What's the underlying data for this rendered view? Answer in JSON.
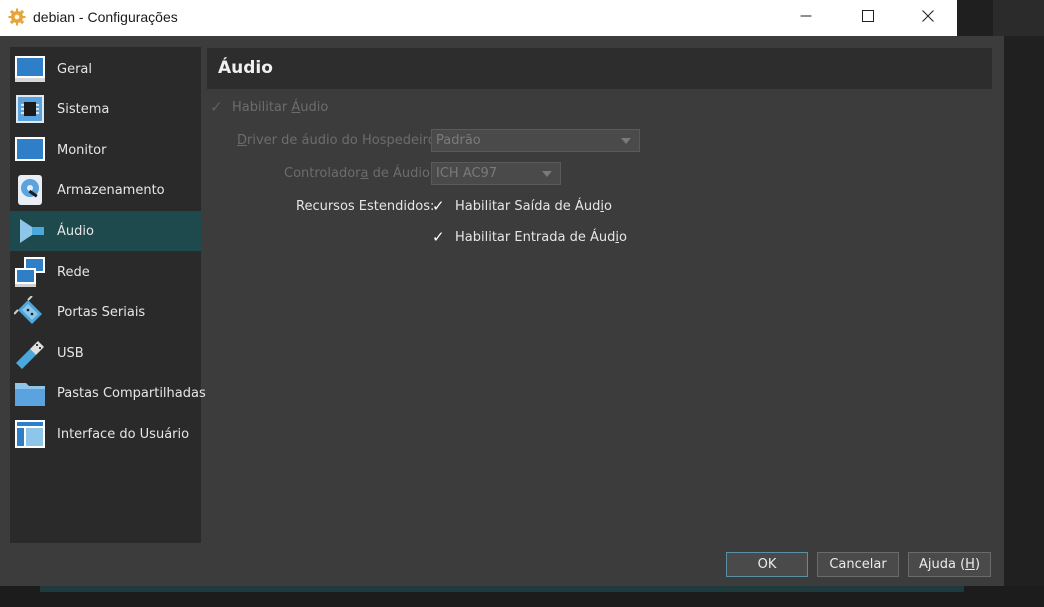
{
  "window": {
    "title": "debian - Configurações",
    "minimize_label": "",
    "maximize_label": "",
    "close_label": ""
  },
  "sidebar": {
    "items": [
      {
        "label": "Geral",
        "icon": "monitor-general-icon"
      },
      {
        "label": "Sistema",
        "icon": "chip-icon"
      },
      {
        "label": "Monitor",
        "icon": "display-icon"
      },
      {
        "label": "Armazenamento",
        "icon": "disk-icon"
      },
      {
        "label": "Áudio",
        "icon": "speaker-icon",
        "selected": true
      },
      {
        "label": "Rede",
        "icon": "network-icon"
      },
      {
        "label": "Portas Seriais",
        "icon": "serial-port-icon"
      },
      {
        "label": "USB",
        "icon": "usb-icon"
      },
      {
        "label": "Pastas Compartilhadas",
        "icon": "folder-icon"
      },
      {
        "label": "Interface do Usuário",
        "icon": "ui-window-icon"
      }
    ]
  },
  "audio": {
    "page_title": "Áudio",
    "enable_audio": {
      "pre": "Habilitar ",
      "u": "Á",
      "post": "udio",
      "checked": true,
      "enabled": false
    },
    "host_driver": {
      "pre": "",
      "u": "D",
      "post": "river de áudio do Hospedeiro:",
      "value": "Padrão",
      "enabled": false
    },
    "controller": {
      "pre": "Controlador",
      "u": "a",
      "post": " de Áudio:",
      "value": "ICH AC97",
      "enabled": false
    },
    "extended_label": "Recursos Estendidos:",
    "output": {
      "pre": "Habilitar Saída de Áud",
      "u": "i",
      "post": "o",
      "checked": true
    },
    "input": {
      "pre": "Habilitar Entrada de Áud",
      "u": "i",
      "post": "o",
      "checked": true
    }
  },
  "buttons": {
    "ok": "OK",
    "cancel": "Cancelar",
    "help_pre": "Ajuda (",
    "help_u": "H",
    "help_post": ")"
  },
  "colors": {
    "selected_bg": "#1f4a4d",
    "window_bg": "#3c3c3c",
    "sidebar_bg": "#2a2a2a",
    "accent_icon": "#4aa8dc"
  }
}
